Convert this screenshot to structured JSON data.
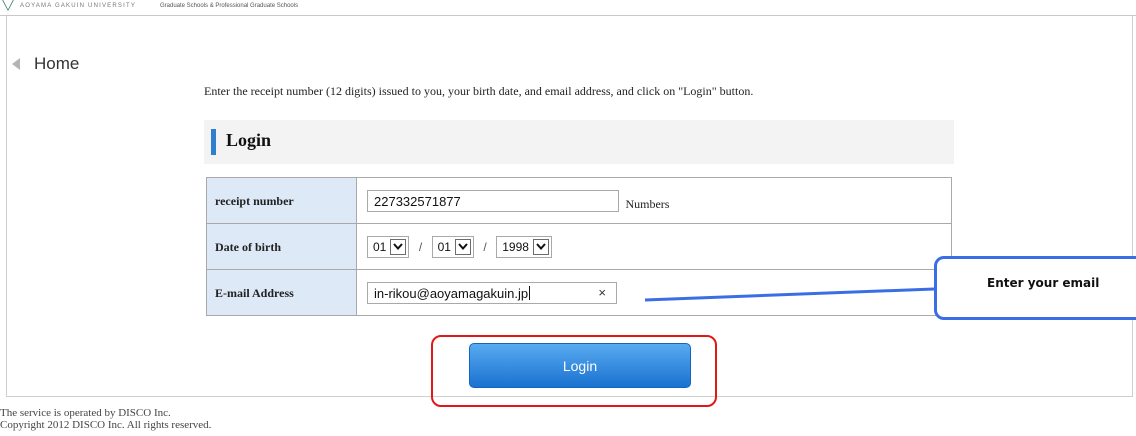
{
  "header": {
    "university": "AOYAMA GAKUIN UNIVERSITY",
    "school": "Graduate Schools & Professional Graduate Schools"
  },
  "nav": {
    "home_label": "Home"
  },
  "instruction": "Enter the receipt number (12 digits) issued to you, your birth date, and email address, and click on \"Login\" button.",
  "login_section": {
    "title": "Login"
  },
  "form": {
    "receipt": {
      "label": "receipt number",
      "value": "227332571877",
      "units": "Numbers"
    },
    "birth": {
      "label": "Date of birth",
      "month": "01",
      "day": "01",
      "year": "1998",
      "separator": "/"
    },
    "email": {
      "label": "E-mail Address",
      "value": "in-rikou@aoyamagakuin.jp",
      "clear": "×"
    }
  },
  "callout": {
    "text": "Enter your email"
  },
  "login_button": {
    "label": "Login"
  },
  "footer": {
    "line1": "The service is operated by DISCO Inc.",
    "line2": "Copyright 2012 DISCO Inc. All rights reserved."
  },
  "colors": {
    "accent": "#2f7fd1",
    "button": "#1a72d0",
    "callout_border": "#3b6ee6",
    "highlight_border": "#e01818",
    "label_cell": "#dde9f7"
  }
}
